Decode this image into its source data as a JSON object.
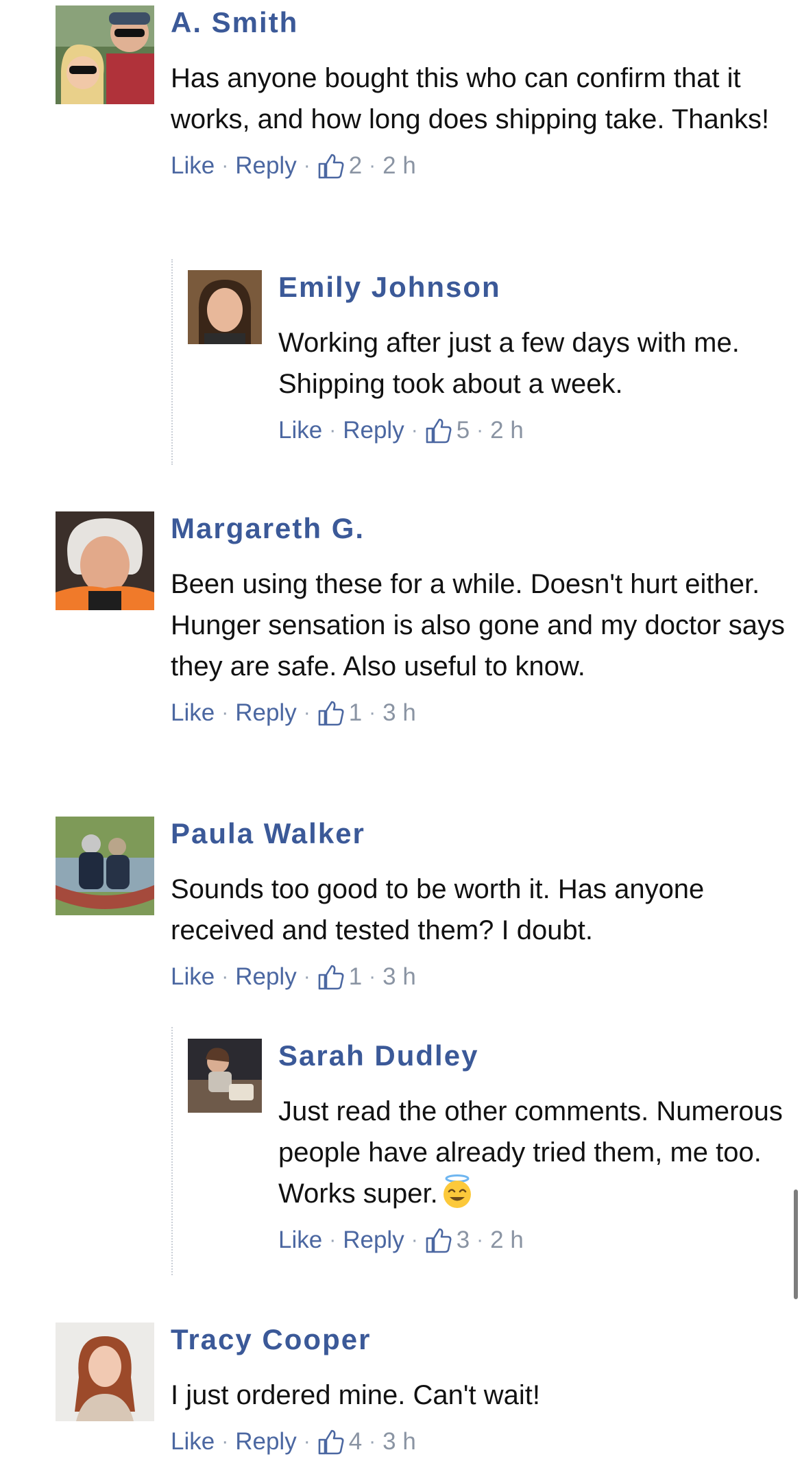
{
  "comments": [
    {
      "name": "A. Smith",
      "text": "Has anyone bought this who can confirm that it works, and how long does shipping take. Thanks!",
      "like_label": "Like",
      "reply_label": "Reply",
      "likes": "2",
      "time": "2 h",
      "reply": {
        "name": "Emily Johnson",
        "text": "Working after just a few days with me. Shipping took about a week.",
        "like_label": "Like",
        "reply_label": "Reply",
        "likes": "5",
        "time": "2 h"
      }
    },
    {
      "name": "Margareth G.",
      "text": "Been using these for a while. Doesn't hurt either. Hunger sensation is also gone and my doctor says they are safe. Also useful to know.",
      "like_label": "Like",
      "reply_label": "Reply",
      "likes": "1",
      "time": "3 h"
    },
    {
      "name": "Paula Walker",
      "text": "Sounds too good to be worth it. Has anyone received and tested them? I doubt.",
      "like_label": "Like",
      "reply_label": "Reply",
      "likes": "1",
      "time": "3 h",
      "reply": {
        "name": "Sarah Dudley",
        "text": "Just read the other comments. Numerous people have already tried them, me too. Works super.",
        "like_label": "Like",
        "reply_label": "Reply",
        "likes": "3",
        "time": "2 h"
      }
    },
    {
      "name": "Tracy Cooper",
      "text": "I just ordered mine. Can't wait!",
      "like_label": "Like",
      "reply_label": "Reply",
      "likes": "4",
      "time": "3 h"
    }
  ],
  "icons": {
    "like": "thumbs-up-icon",
    "emoji": "smiling-face-with-halo"
  },
  "colors": {
    "name": "#3b5998",
    "link": "#4b67a1",
    "meta": "#8a94a3"
  }
}
